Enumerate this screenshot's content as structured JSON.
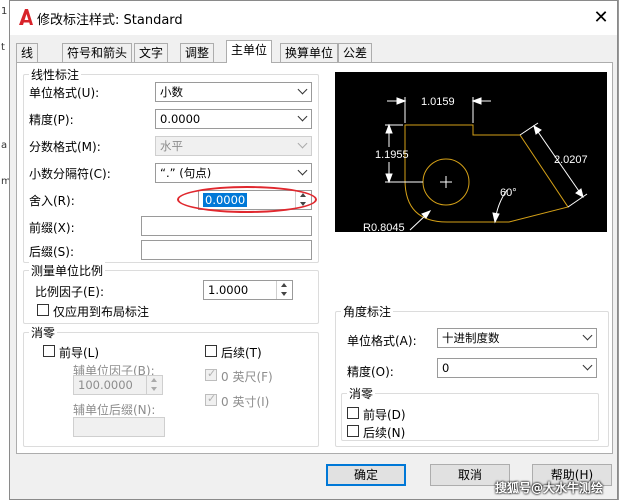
{
  "window": {
    "title": "修改标注样式: Standard",
    "close_glyph": "✕"
  },
  "tabs": [
    "线",
    "符号和箭头",
    "文字",
    "调整",
    "主单位",
    "换算单位",
    "公差"
  ],
  "linear": {
    "group_title": "线性标注",
    "unit_format_label": "单位格式(U):",
    "unit_format_value": "小数",
    "precision_label": "精度(P):",
    "precision_value": "0.0000",
    "fraction_label": "分数格式(M):",
    "fraction_value": "水平",
    "decimal_sep_label": "小数分隔符(C):",
    "decimal_sep_value": "“.” (句点)",
    "round_label": "舍入(R):",
    "round_value": "0.0000",
    "prefix_label": "前缀(X):",
    "prefix_value": "",
    "suffix_label": "后缀(S):",
    "suffix_value": ""
  },
  "scale": {
    "group_title": "测量单位比例",
    "factor_label": "比例因子(E):",
    "factor_value": "1.0000",
    "layout_only_label": "仅应用到布局标注"
  },
  "zero": {
    "group_title": "消零",
    "leading_label": "前导(L)",
    "sub_factor_label": "辅单位因子(B):",
    "sub_factor_value": "100.0000",
    "sub_suffix_label": "辅单位后缀(N):",
    "sub_suffix_value": "",
    "trailing_label": "后续(T)",
    "feet_label": "0 英尺(F)",
    "inches_label": "0 英寸(I)"
  },
  "angular": {
    "group_title": "角度标注",
    "unit_format_label": "单位格式(A):",
    "unit_format_value": "十进制度数",
    "precision_label": "精度(O):",
    "precision_value": "0",
    "zero_title": "消零",
    "leading_label": "前导(D)",
    "trailing_label": "后续(N)"
  },
  "preview": {
    "dim_top": "1.0159",
    "dim_left": "1.1955",
    "dim_right": "2.0207",
    "dim_angle": "60°",
    "dim_radius": "R0.8045",
    "line_color": "#d4a017"
  },
  "buttons": {
    "ok": "确定",
    "cancel": "取消",
    "help": "帮助(H)"
  },
  "watermark": "搜狐号@大水牛测绘",
  "left_strip": [
    "1",
    "t",
    "a",
    "m"
  ]
}
